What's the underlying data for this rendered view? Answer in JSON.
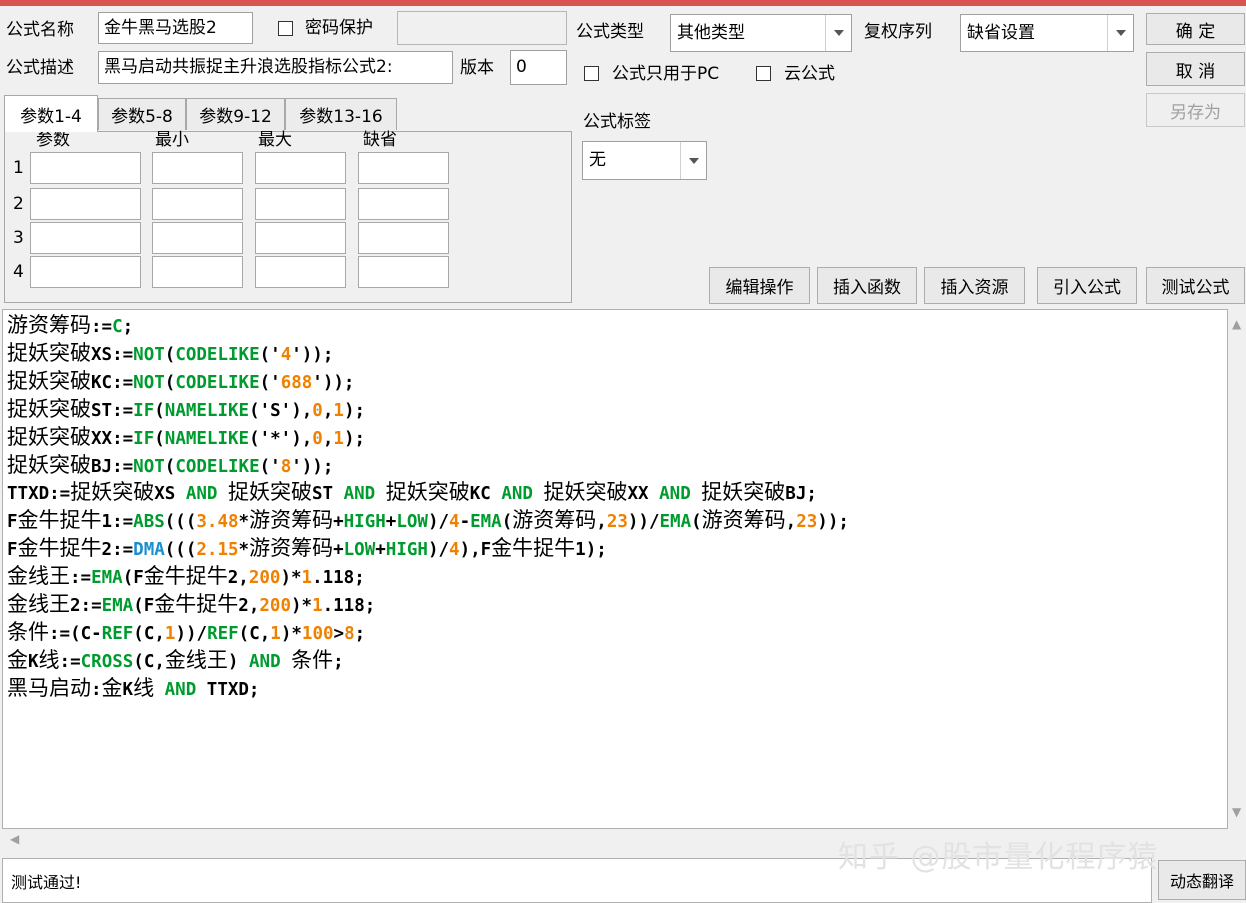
{
  "header": {
    "name_label": "公式名称",
    "name_value": "金牛黑马选股2",
    "password_label": "密码保护",
    "desc_label": "公式描述",
    "desc_value": "黑马启动共振捉主升浪选股指标公式2:",
    "version_label": "版本",
    "version_value": "0",
    "type_label": "公式类型",
    "type_value": "其他类型",
    "rights_label": "复权序列",
    "rights_value": "缺省设置",
    "pc_only_label": "公式只用于PC",
    "cloud_label": "云公式",
    "tag_label": "公式标签",
    "tag_value": "无"
  },
  "buttons": {
    "ok": "确  定",
    "cancel": "取  消",
    "save_as": "另存为",
    "edit_ops": "编辑操作",
    "insert_func": "插入函数",
    "insert_res": "插入资源",
    "import_formula": "引入公式",
    "test_formula": "测试公式",
    "dynamic_translate": "动态翻译"
  },
  "tabs": [
    "参数1-4",
    "参数5-8",
    "参数9-12",
    "参数13-16"
  ],
  "params": {
    "headers": [
      "参数",
      "最小",
      "最大",
      "缺省"
    ],
    "rows": [
      "1",
      "2",
      "3",
      "4"
    ]
  },
  "code_lines": [
    [
      [
        "t",
        "游资筹码"
      ],
      [
        "p",
        ":="
      ],
      [
        "k",
        "C"
      ],
      [
        "p",
        ";"
      ]
    ],
    [
      [
        "t",
        "捉妖突破"
      ],
      [
        "p",
        "XS:="
      ],
      [
        "k",
        "NOT"
      ],
      [
        "p",
        "("
      ],
      [
        "k",
        "CODELIKE"
      ],
      [
        "p",
        "('"
      ],
      [
        "n",
        "4"
      ],
      [
        "p",
        "'));"
      ]
    ],
    [
      [
        "t",
        "捉妖突破"
      ],
      [
        "p",
        "KC:="
      ],
      [
        "k",
        "NOT"
      ],
      [
        "p",
        "("
      ],
      [
        "k",
        "CODELIKE"
      ],
      [
        "p",
        "('"
      ],
      [
        "n",
        "688"
      ],
      [
        "p",
        "'));"
      ]
    ],
    [
      [
        "t",
        "捉妖突破"
      ],
      [
        "p",
        "ST:="
      ],
      [
        "k",
        "IF"
      ],
      [
        "p",
        "("
      ],
      [
        "k",
        "NAMELIKE"
      ],
      [
        "p",
        "('S'),"
      ],
      [
        "n",
        "0"
      ],
      [
        "p",
        ","
      ],
      [
        "n",
        "1"
      ],
      [
        "p",
        ");"
      ]
    ],
    [
      [
        "t",
        "捉妖突破"
      ],
      [
        "p",
        "XX:="
      ],
      [
        "k",
        "IF"
      ],
      [
        "p",
        "("
      ],
      [
        "k",
        "NAMELIKE"
      ],
      [
        "p",
        "('*'),"
      ],
      [
        "n",
        "0"
      ],
      [
        "p",
        ","
      ],
      [
        "n",
        "1"
      ],
      [
        "p",
        ");"
      ]
    ],
    [
      [
        "t",
        "捉妖突破"
      ],
      [
        "p",
        "BJ:="
      ],
      [
        "k",
        "NOT"
      ],
      [
        "p",
        "("
      ],
      [
        "k",
        "CODELIKE"
      ],
      [
        "p",
        "('"
      ],
      [
        "n",
        "8"
      ],
      [
        "p",
        "'));"
      ]
    ],
    [
      [
        "p",
        "TTXD:="
      ],
      [
        "t",
        "捉妖突破"
      ],
      [
        "p",
        "XS "
      ],
      [
        "k",
        "AND"
      ],
      [
        "p",
        " "
      ],
      [
        "t",
        "捉妖突破"
      ],
      [
        "p",
        "ST "
      ],
      [
        "k",
        "AND"
      ],
      [
        "p",
        " "
      ],
      [
        "t",
        "捉妖突破"
      ],
      [
        "p",
        "KC "
      ],
      [
        "k",
        "AND"
      ],
      [
        "p",
        " "
      ],
      [
        "t",
        "捉妖突破"
      ],
      [
        "p",
        "XX "
      ],
      [
        "k",
        "AND"
      ],
      [
        "p",
        " "
      ],
      [
        "t",
        "捉妖突破"
      ],
      [
        "p",
        "BJ;"
      ]
    ],
    [
      [
        "p",
        "F"
      ],
      [
        "t",
        "金牛捉牛"
      ],
      [
        "p",
        "1:="
      ],
      [
        "k",
        "ABS"
      ],
      [
        "p",
        "((("
      ],
      [
        "n",
        "3.48"
      ],
      [
        "p",
        "*"
      ],
      [
        "t",
        "游资筹码"
      ],
      [
        "p",
        "+"
      ],
      [
        "k",
        "HIGH"
      ],
      [
        "p",
        "+"
      ],
      [
        "k",
        "LOW"
      ],
      [
        "p",
        ")/"
      ],
      [
        "n",
        "4"
      ],
      [
        "p",
        "-"
      ],
      [
        "k",
        "EMA"
      ],
      [
        "p",
        "("
      ],
      [
        "t",
        "游资筹码"
      ],
      [
        "p",
        ","
      ],
      [
        "n",
        "23"
      ],
      [
        "p",
        "))/"
      ],
      [
        "k",
        "EMA"
      ],
      [
        "p",
        "("
      ],
      [
        "t",
        "游资筹码"
      ],
      [
        "p",
        ","
      ],
      [
        "n",
        "23"
      ],
      [
        "p",
        "));"
      ]
    ],
    [
      [
        "p",
        "F"
      ],
      [
        "t",
        "金牛捉牛"
      ],
      [
        "p",
        "2:="
      ],
      [
        "f",
        "DMA"
      ],
      [
        "p",
        "((("
      ],
      [
        "n",
        "2.15"
      ],
      [
        "p",
        "*"
      ],
      [
        "t",
        "游资筹码"
      ],
      [
        "p",
        "+"
      ],
      [
        "k",
        "LOW"
      ],
      [
        "p",
        "+"
      ],
      [
        "k",
        "HIGH"
      ],
      [
        "p",
        ")/"
      ],
      [
        "n",
        "4"
      ],
      [
        "p",
        "),F"
      ],
      [
        "t",
        "金牛捉牛"
      ],
      [
        "p",
        "1);"
      ]
    ],
    [
      [
        "t",
        "金线王"
      ],
      [
        "p",
        ":="
      ],
      [
        "k",
        "EMA"
      ],
      [
        "p",
        "(F"
      ],
      [
        "t",
        "金牛捉牛"
      ],
      [
        "p",
        "2,"
      ],
      [
        "n",
        "200"
      ],
      [
        "p",
        ")*"
      ],
      [
        "n",
        "1"
      ],
      [
        "p",
        ".118;"
      ]
    ],
    [
      [
        "t",
        "金线王"
      ],
      [
        "p",
        "2:="
      ],
      [
        "k",
        "EMA"
      ],
      [
        "p",
        "(F"
      ],
      [
        "t",
        "金牛捉牛"
      ],
      [
        "p",
        "2,"
      ],
      [
        "n",
        "200"
      ],
      [
        "p",
        ")*"
      ],
      [
        "n",
        "1"
      ],
      [
        "p",
        ".118;"
      ]
    ],
    [
      [
        "t",
        "条件"
      ],
      [
        "p",
        ":=(C-"
      ],
      [
        "k",
        "REF"
      ],
      [
        "p",
        "(C,"
      ],
      [
        "n",
        "1"
      ],
      [
        "p",
        "))/"
      ],
      [
        "k",
        "REF"
      ],
      [
        "p",
        "(C,"
      ],
      [
        "n",
        "1"
      ],
      [
        "p",
        ")*"
      ],
      [
        "n",
        "100"
      ],
      [
        "p",
        ">"
      ],
      [
        "n",
        "8"
      ],
      [
        "p",
        ";"
      ]
    ],
    [
      [
        "t",
        "金"
      ],
      [
        "p",
        "K"
      ],
      [
        "t",
        "线"
      ],
      [
        "p",
        ":="
      ],
      [
        "k",
        "CROSS"
      ],
      [
        "p",
        "(C,"
      ],
      [
        "t",
        "金线王"
      ],
      [
        "p",
        ") "
      ],
      [
        "k",
        "AND"
      ],
      [
        "p",
        " "
      ],
      [
        "t",
        "条件"
      ],
      [
        "p",
        ";"
      ]
    ],
    [
      [
        "t",
        "黑马启动"
      ],
      [
        "p",
        ":"
      ],
      [
        "t",
        "金"
      ],
      [
        "p",
        "K"
      ],
      [
        "t",
        "线"
      ],
      [
        "p",
        " "
      ],
      [
        "k",
        "AND"
      ],
      [
        "p",
        " TTXD;"
      ]
    ]
  ],
  "status": {
    "message": "测试通过!"
  },
  "watermark": "知乎 @股市量化程序猿",
  "colors": {
    "keyword": "#009b2e",
    "number": "#f08000",
    "function_dma": "#1a8fd0",
    "top_bar": "#d9534f"
  }
}
